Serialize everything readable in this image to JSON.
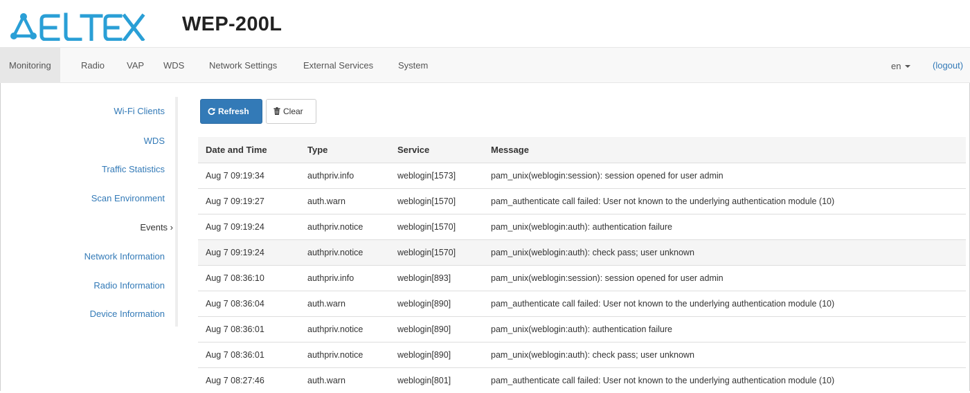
{
  "header": {
    "logo_text": "ELTEX",
    "model": "WEP-200L"
  },
  "colors": {
    "brand": "#2a9fd6",
    "link": "#337ab7",
    "primary_button": "#337ab7"
  },
  "nav": {
    "items": [
      {
        "label": "Monitoring",
        "active": true
      },
      {
        "label": "Radio"
      },
      {
        "label": "VAP"
      },
      {
        "label": "WDS"
      },
      {
        "label": "Network Settings"
      },
      {
        "label": "External Services"
      },
      {
        "label": "System"
      }
    ],
    "language": "en",
    "logout": "(logout)"
  },
  "sidebar": {
    "items": [
      {
        "label": "Wi-Fi Clients"
      },
      {
        "label": "WDS"
      },
      {
        "label": "Traffic Statistics"
      },
      {
        "label": "Scan Environment"
      },
      {
        "label": "Events ›",
        "active": true
      },
      {
        "label": "Network Information"
      },
      {
        "label": "Radio Information"
      },
      {
        "label": "Device Information"
      }
    ]
  },
  "toolbar": {
    "refresh_label": "Refresh",
    "refresh_icon": "refresh-icon",
    "clear_label": "Clear",
    "clear_icon": "trash-icon"
  },
  "table": {
    "headers": [
      "Date and Time",
      "Type",
      "Service",
      "Message"
    ],
    "rows": [
      [
        "Aug 7 09:19:34",
        "authpriv.info",
        "weblogin[1573]",
        "pam_unix(weblogin:session): session opened for user admin"
      ],
      [
        "Aug 7 09:19:27",
        "auth.warn",
        "weblogin[1570]",
        "pam_authenticate call failed: User not known to the underlying authentication module (10)"
      ],
      [
        "Aug 7 09:19:24",
        "authpriv.notice",
        "weblogin[1570]",
        "pam_unix(weblogin:auth): authentication failure"
      ],
      [
        "Aug 7 09:19:24",
        "authpriv.notice",
        "weblogin[1570]",
        "pam_unix(weblogin:auth): check pass; user unknown"
      ],
      [
        "Aug 7 08:36:10",
        "authpriv.info",
        "weblogin[893]",
        "pam_unix(weblogin:session): session opened for user admin"
      ],
      [
        "Aug 7 08:36:04",
        "auth.warn",
        "weblogin[890]",
        "pam_authenticate call failed: User not known to the underlying authentication module (10)"
      ],
      [
        "Aug 7 08:36:01",
        "authpriv.notice",
        "weblogin[890]",
        "pam_unix(weblogin:auth): authentication failure"
      ],
      [
        "Aug 7 08:36:01",
        "authpriv.notice",
        "weblogin[890]",
        "pam_unix(weblogin:auth): check pass; user unknown"
      ],
      [
        "Aug 7 08:27:46",
        "auth.warn",
        "weblogin[801]",
        "pam_authenticate call failed: User not known to the underlying authentication module (10)"
      ]
    ]
  }
}
